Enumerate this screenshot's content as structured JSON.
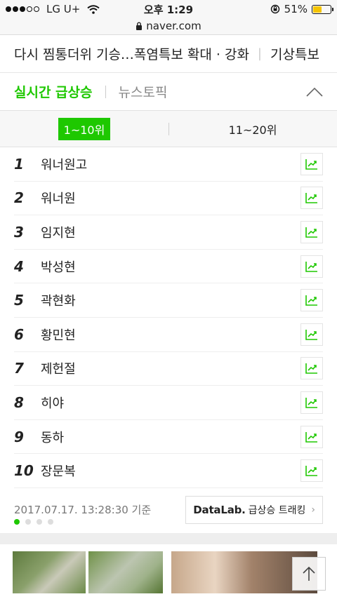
{
  "status_bar": {
    "carrier": "LG U+",
    "time": "오후 1:29",
    "battery": "51%",
    "url": "naver.com",
    "battery_color": "#f5c400"
  },
  "headline": {
    "left": "다시 찜통더위 기승…폭염특보 확대 · 강화",
    "right": "기상특보"
  },
  "rank_tabs": {
    "active": "실시간 급상승",
    "inactive": "뉴스토픽"
  },
  "range_tabs": {
    "active": "1~10위",
    "inactive": "11~20위"
  },
  "rankings": [
    {
      "rank": "1",
      "keyword": "워너원고"
    },
    {
      "rank": "2",
      "keyword": "워너원"
    },
    {
      "rank": "3",
      "keyword": "임지현"
    },
    {
      "rank": "4",
      "keyword": "박성현"
    },
    {
      "rank": "5",
      "keyword": "곽현화"
    },
    {
      "rank": "6",
      "keyword": "황민현"
    },
    {
      "rank": "7",
      "keyword": "제헌절"
    },
    {
      "rank": "8",
      "keyword": "히야"
    },
    {
      "rank": "9",
      "keyword": "동하"
    },
    {
      "rank": "10",
      "keyword": "장문복"
    }
  ],
  "footer": {
    "timestamp": "2017.07.17. 13:28:30 기준",
    "datalab_name": "DataLab.",
    "datalab_suffix": "급상승 트래킹"
  },
  "colors": {
    "accent": "#1ec800"
  }
}
